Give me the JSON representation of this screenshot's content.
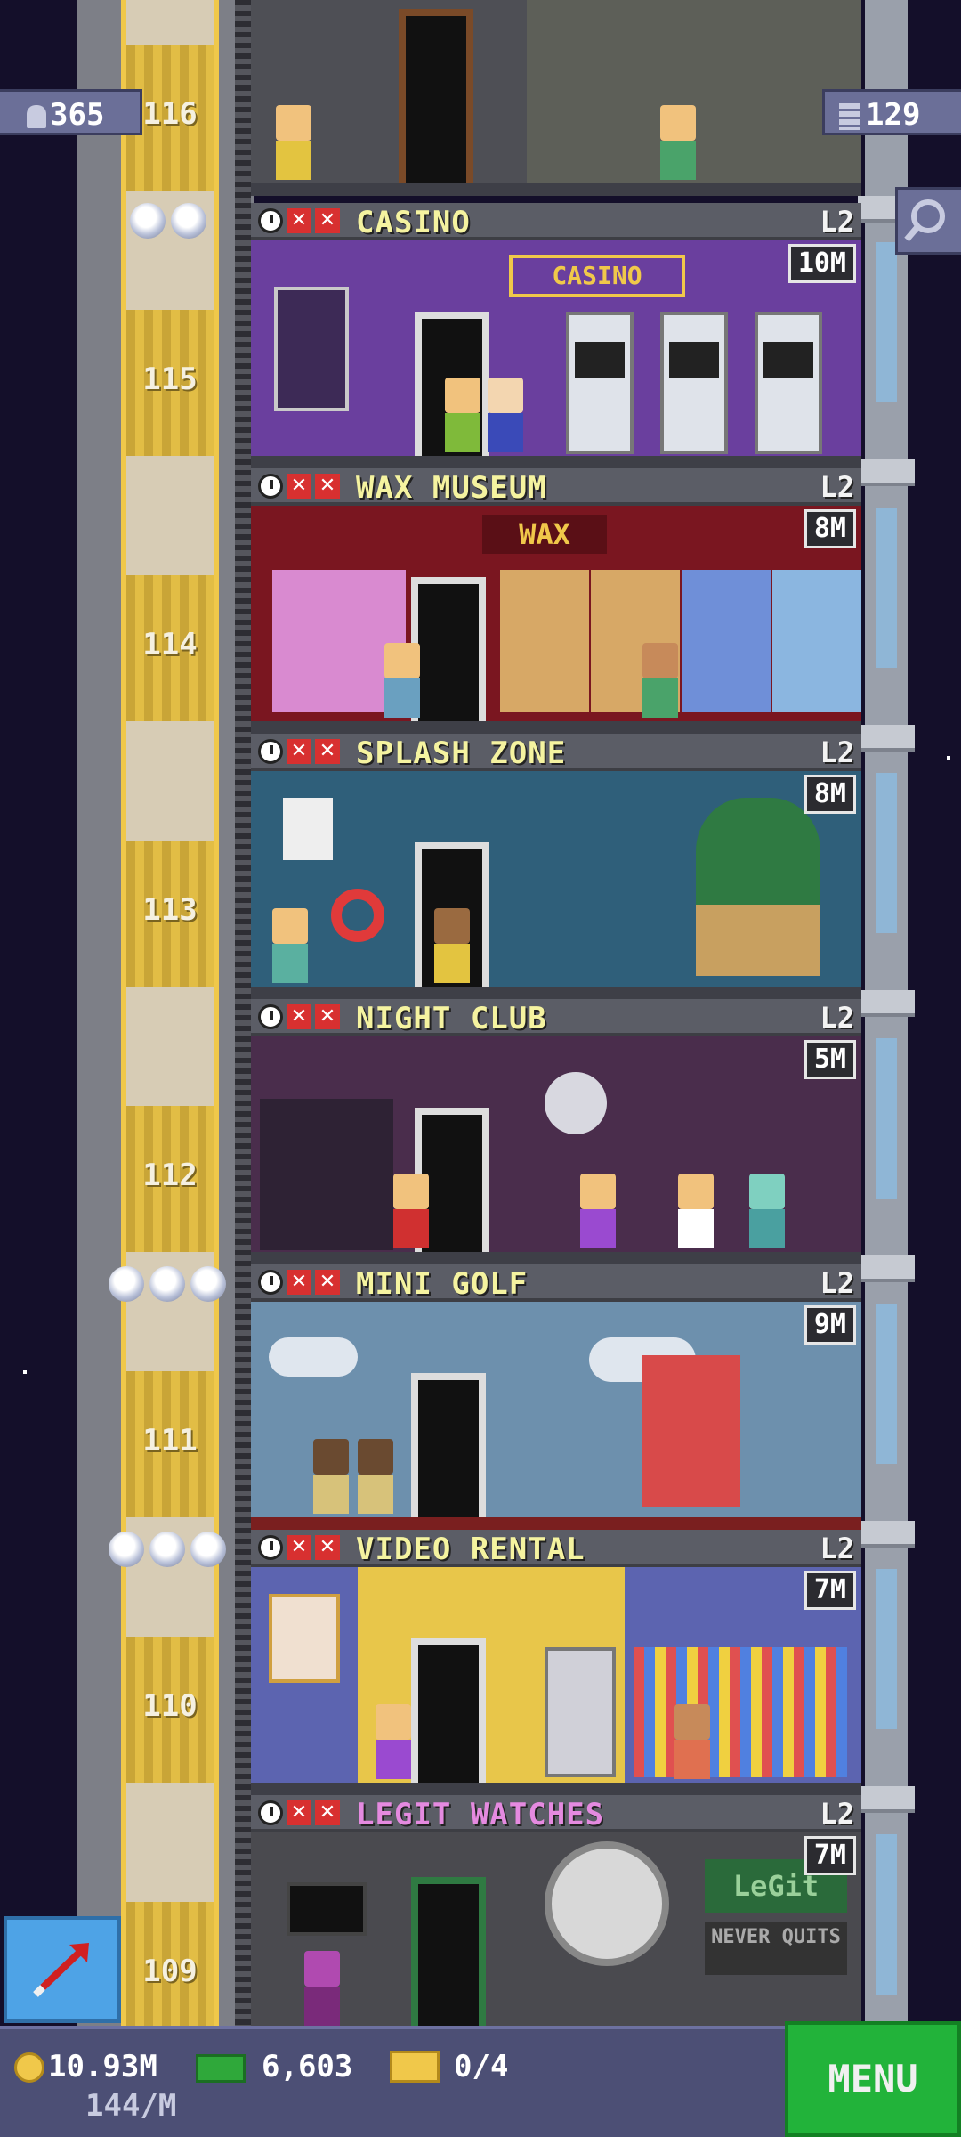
{
  "hud": {
    "population": "365",
    "floors": "129",
    "coins": "10.93M",
    "coin_rate": "144/M",
    "bux": "6,603",
    "tickets": "0/4",
    "menu_label": "MENU"
  },
  "floor_numbers": [
    "116",
    "115",
    "114",
    "113",
    "112",
    "111",
    "110",
    "109"
  ],
  "floors": [
    {
      "name": "CASINO",
      "level": "L2",
      "income": "10M",
      "sign": "CASINO"
    },
    {
      "name": "WAX MUSEUM",
      "level": "L2",
      "income": "8M",
      "sign": "WAX"
    },
    {
      "name": "SPLASH ZONE",
      "level": "L2",
      "income": "8M"
    },
    {
      "name": "NIGHT CLUB",
      "level": "L2",
      "income": "5M"
    },
    {
      "name": "MINI GOLF",
      "level": "L2",
      "income": "9M"
    },
    {
      "name": "VIDEO RENTAL",
      "level": "L2",
      "income": "7M"
    },
    {
      "name": "LEGIT WATCHES",
      "level": "L2",
      "income": "7M",
      "sign": "LeGit",
      "sign2": "NEVER QUITS"
    }
  ],
  "colors": {
    "casino_bg": "#6a3f9e",
    "wax_bg": "#7a1620",
    "splash_bg": "#2f5f7a",
    "night_bg": "#4a2d4c",
    "golf_bg": "#6d90ad",
    "video_bg": "#e8c64a",
    "watches_bg": "#4a4a4f",
    "menu_green": "#22b33a",
    "legit_name": "#e58ae0"
  }
}
